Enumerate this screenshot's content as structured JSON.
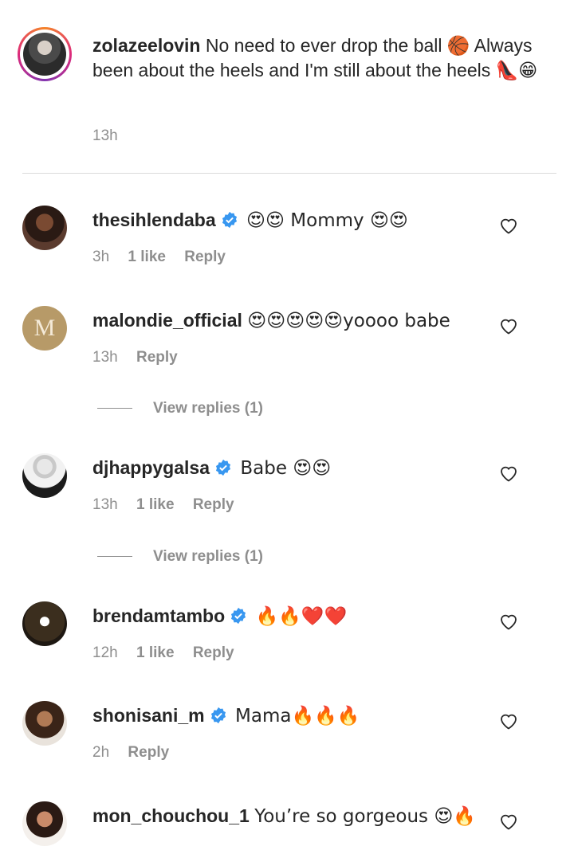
{
  "caption": {
    "username": "zolazeelovin",
    "text": "No need to ever drop the ball 🏀 Always been about the heels and I'm still about the heels 👠😁",
    "time": "13h"
  },
  "comments": [
    {
      "username": "thesihlendaba",
      "verified": true,
      "text": "😍😍 Mommy 😍😍",
      "time": "3h",
      "likes": "1 like",
      "reply": "Reply"
    },
    {
      "username": "malondie_official",
      "verified": false,
      "text": "😍😍😍😍😍yoooo babe",
      "time": "13h",
      "likes": "",
      "reply": "Reply",
      "view_replies": "View replies (1)"
    },
    {
      "username": "djhappygalsa",
      "verified": true,
      "text": "Babe 😍😍",
      "time": "13h",
      "likes": "1 like",
      "reply": "Reply",
      "view_replies": "View replies (1)"
    },
    {
      "username": "brendamtambo",
      "verified": true,
      "text": "🔥🔥❤️❤️",
      "time": "12h",
      "likes": "1 like",
      "reply": "Reply"
    },
    {
      "username": "shonisani_m",
      "verified": true,
      "text": "Mama🔥🔥🔥",
      "time": "2h",
      "likes": "",
      "reply": "Reply"
    },
    {
      "username": "mon_chouchou_1",
      "verified": false,
      "text": "You’re so gorgeous 😍🔥",
      "time": "",
      "likes": "",
      "reply": ""
    }
  ],
  "malondie_avatar_letter": "M",
  "colors": {
    "accent_verified": "#3897f0",
    "muted": "#8e8e8e",
    "text": "#262626"
  }
}
